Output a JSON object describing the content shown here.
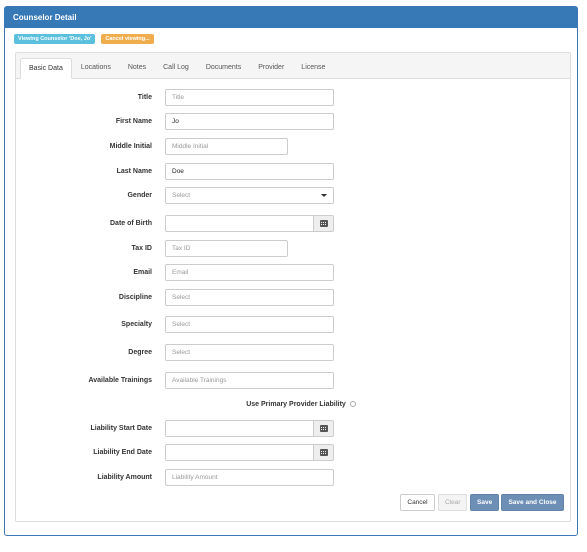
{
  "panel": {
    "title": "Counselor Detail"
  },
  "badges": {
    "viewing": "Viewing Counselor 'Doe, Jo'",
    "cancel": "Cancel viewing..."
  },
  "tabs": [
    {
      "label": "Basic Data",
      "active": true
    },
    {
      "label": "Locations"
    },
    {
      "label": "Notes"
    },
    {
      "label": "Call Log"
    },
    {
      "label": "Documents"
    },
    {
      "label": "Provider"
    },
    {
      "label": "License"
    }
  ],
  "form": {
    "title": {
      "label": "Title",
      "value": "",
      "placeholder": "Title"
    },
    "first_name": {
      "label": "First Name",
      "value": "Jo",
      "placeholder": ""
    },
    "middle_initial": {
      "label": "Middle Initial",
      "value": "",
      "placeholder": "Middle Initial"
    },
    "last_name": {
      "label": "Last Name",
      "value": "Doe",
      "placeholder": ""
    },
    "gender": {
      "label": "Gender",
      "value": "Select"
    },
    "dob": {
      "label": "Date of Birth",
      "value": ""
    },
    "tax_id": {
      "label": "Tax ID",
      "value": "",
      "placeholder": "Tax ID"
    },
    "email": {
      "label": "Email",
      "value": "",
      "placeholder": "Email"
    },
    "discipline": {
      "label": "Discipline",
      "value": "Select"
    },
    "specialty": {
      "label": "Specialty",
      "value": "Select"
    },
    "degree": {
      "label": "Degree",
      "value": "Select"
    },
    "trainings": {
      "label": "Available Trainings",
      "value": "",
      "placeholder": "Available Trainings"
    },
    "use_primary": {
      "label": "Use Primary Provider Liability",
      "checked": false
    },
    "liability_start": {
      "label": "Liability Start Date",
      "value": ""
    },
    "liability_end": {
      "label": "Liability End Date",
      "value": ""
    },
    "liability_amount": {
      "label": "Liability Amount",
      "value": "",
      "placeholder": "Liability Amount"
    }
  },
  "buttons": {
    "cancel": "Cancel",
    "clear": "Clear",
    "save": "Save",
    "save_close": "Save and Close"
  },
  "colors": {
    "header": "#3778b7",
    "info_badge": "#5bc0de",
    "warn_badge": "#f0ad4e",
    "primary_button": "#6d8fb5"
  },
  "icons": {
    "date_picker": "calendar-icon",
    "dropdown": "caret-down-icon"
  }
}
